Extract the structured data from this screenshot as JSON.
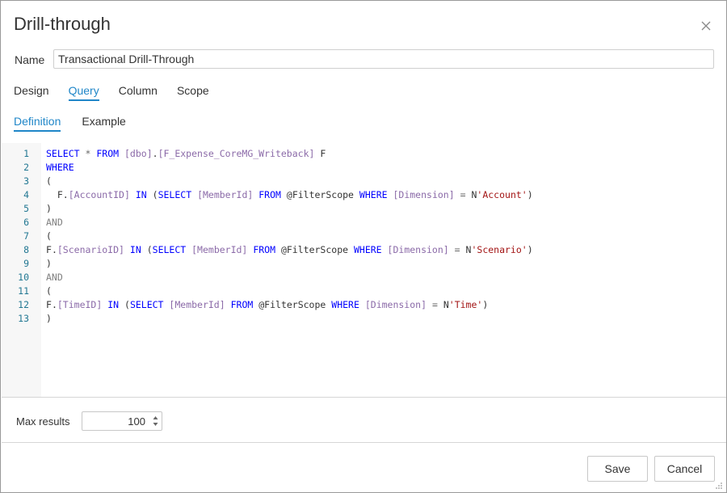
{
  "dialog": {
    "title": "Drill-through",
    "close_icon": "close-icon"
  },
  "name": {
    "label": "Name",
    "value": "Transactional Drill-Through"
  },
  "tabs": [
    {
      "label": "Design",
      "active": false
    },
    {
      "label": "Query",
      "active": true
    },
    {
      "label": "Column",
      "active": false
    },
    {
      "label": "Scope",
      "active": false
    }
  ],
  "subtabs": [
    {
      "label": "Definition",
      "active": true
    },
    {
      "label": "Example",
      "active": false
    }
  ],
  "editor": {
    "lines": [
      {
        "n": "1",
        "text": "SELECT * FROM [dbo].[F_Expense_CoreMG_Writeback] F"
      },
      {
        "n": "2",
        "text": "WHERE"
      },
      {
        "n": "3",
        "text": "("
      },
      {
        "n": "4",
        "text": "  F.[AccountID] IN (SELECT [MemberId] FROM @FilterScope WHERE [Dimension] = N'Account')"
      },
      {
        "n": "5",
        "text": ")"
      },
      {
        "n": "6",
        "text": "AND"
      },
      {
        "n": "7",
        "text": "("
      },
      {
        "n": "8",
        "text": "F.[ScenarioID] IN (SELECT [MemberId] FROM @FilterScope WHERE [Dimension] = N'Scenario')"
      },
      {
        "n": "9",
        "text": ")"
      },
      {
        "n": "10",
        "text": "AND"
      },
      {
        "n": "11",
        "text": "("
      },
      {
        "n": "12",
        "text": "F.[TimeID] IN (SELECT [MemberId] FROM @FilterScope WHERE [Dimension] = N'Time')"
      },
      {
        "n": "13",
        "text": ")"
      }
    ]
  },
  "max_results": {
    "label": "Max results",
    "value": "100"
  },
  "buttons": {
    "save": "Save",
    "cancel": "Cancel"
  },
  "colors": {
    "accent": "#1f86c8",
    "keyword": "#0000ff",
    "identifier": "#8b6aa8",
    "string": "#a31515",
    "line_number": "#237893"
  }
}
